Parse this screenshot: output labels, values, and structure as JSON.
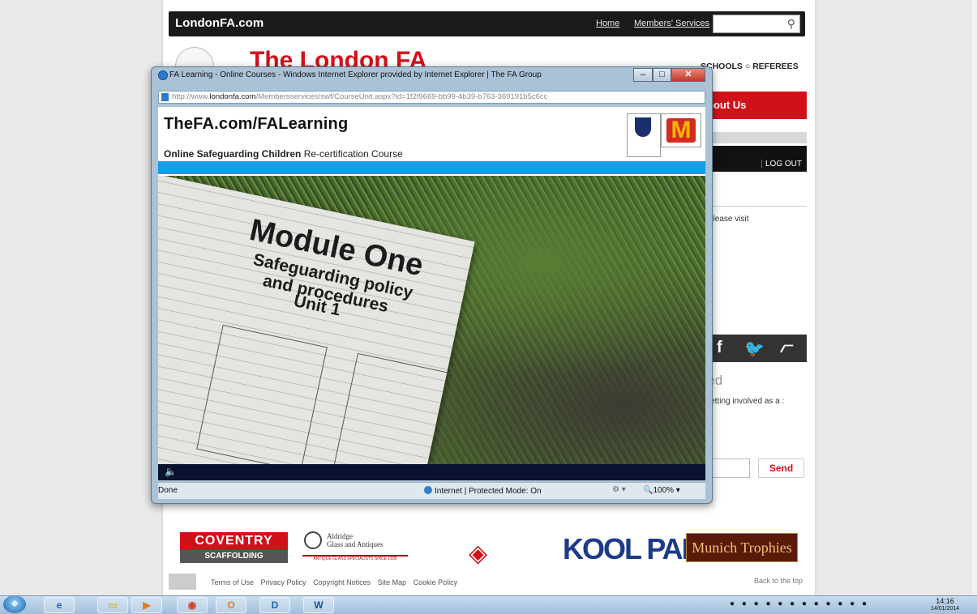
{
  "site": {
    "brand": "LondonFA.com",
    "nav": [
      "Home",
      "Members' Services"
    ],
    "title": "The London FA",
    "section_links": "SCHOOLS ○ REFEREES",
    "menu_partial": "bout Us",
    "logout": "LOG OUT",
    "please_visit": "please visit",
    "involved_heading": "lved",
    "involved_text": "in getting involved as a :",
    "send_label": "Send",
    "sponsors": {
      "coventry_top": "COVENTRY",
      "coventry_bottom": "SCAFFOLDING",
      "aldridge_1": "Aldridge",
      "aldridge_2": "Glass and Antiques",
      "aldridge_3": "ANTIQUE GLASS SPECIALISTS SINCE 1936",
      "koolpak": "KOOL PAK",
      "munich": "Munich Trophies"
    },
    "footer_links": [
      "Terms of Use",
      "Privacy Policy",
      "Copyright Notices",
      "Site Map",
      "Cookie Policy"
    ],
    "back_to_top": "Back to the top"
  },
  "popup": {
    "window_title": "FA Learning - Online Courses - Windows Internet Explorer provided by Internet Explorer | The FA Group",
    "url_prefix": "http://www.",
    "url_domain": "londonfa.com",
    "url_rest": "/Membersservices/swf/CourseUnit.aspx?id=1f2f9669-bb99-4b39-b763-369191b5c6cc",
    "heading": "TheFA.com/FALearning",
    "course_bold": "Online Safeguarding Children",
    "course_rest": " Re-certification Course",
    "slide": {
      "line1": "Module One",
      "line2": "Safeguarding policy",
      "line3": "and procedures",
      "line4": "Unit 1"
    },
    "status_done": "Done",
    "status_zone": "Internet | Protected Mode: On",
    "zoom": "100%"
  },
  "taskbar": {
    "time": "14:16",
    "date": "14/01/2014"
  },
  "colors": {
    "fa_red": "#d1111a",
    "fa_blue_bar": "#1a9be6",
    "player_bar": "#0c1330"
  }
}
